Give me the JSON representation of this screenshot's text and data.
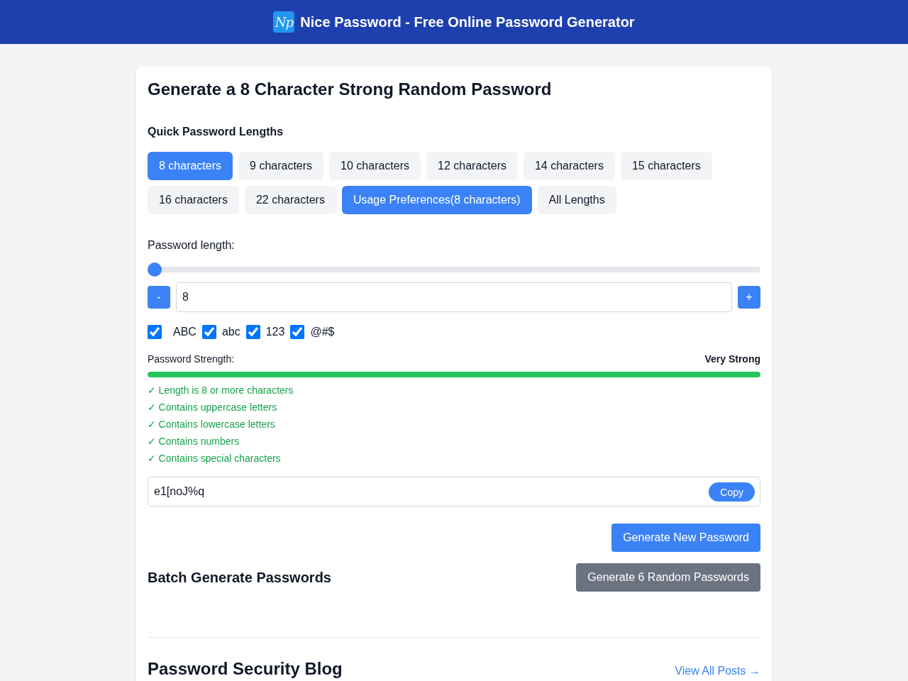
{
  "header": {
    "logo_text": "Np",
    "title": "Nice Password - Free Online Password Generator"
  },
  "generator": {
    "title": "Generate a 8 Character Strong Random Password",
    "quick_lengths": {
      "heading": "Quick Password Lengths",
      "options": [
        {
          "label": "8 characters",
          "selected": true
        },
        {
          "label": "9 characters",
          "selected": false
        },
        {
          "label": "10 characters",
          "selected": false
        },
        {
          "label": "12 characters",
          "selected": false
        },
        {
          "label": "14 characters",
          "selected": false
        },
        {
          "label": "15 characters",
          "selected": false
        },
        {
          "label": "16 characters",
          "selected": false
        },
        {
          "label": "22 characters",
          "selected": false
        },
        {
          "label": "Usage Preferences(8 characters)",
          "selected": true
        },
        {
          "label": "All Lengths",
          "selected": false
        }
      ]
    },
    "length": {
      "label": "Password length:",
      "slider": {
        "level": 0
      },
      "decrement": "-",
      "value": "8",
      "increment": "+"
    },
    "charsets": [
      {
        "label": "ABC",
        "checked": true
      },
      {
        "label": "abc",
        "checked": true
      },
      {
        "label": "123",
        "checked": true
      },
      {
        "label": "@#$",
        "checked": true
      }
    ],
    "strength": {
      "label": "Password Strength:",
      "rating": "Very Strong",
      "level": 1,
      "criteria": [
        {
          "text": "✓ Length is 8 or more characters",
          "met": true
        },
        {
          "text": "✓ Contains uppercase letters",
          "met": true
        },
        {
          "text": "✓ Contains lowercase letters",
          "met": true
        },
        {
          "text": "✓ Contains numbers",
          "met": true
        },
        {
          "text": "✓ Contains special characters",
          "met": true
        }
      ]
    },
    "password": {
      "value": "e1[noJ%q",
      "copy_button": "Copy"
    },
    "generate_button": "Generate New Password",
    "batch": {
      "title": "Batch Generate Passwords",
      "button": "Generate 6 Random Passwords"
    }
  },
  "blog": {
    "title": "Password Security Blog",
    "link": "View All Posts →"
  }
}
